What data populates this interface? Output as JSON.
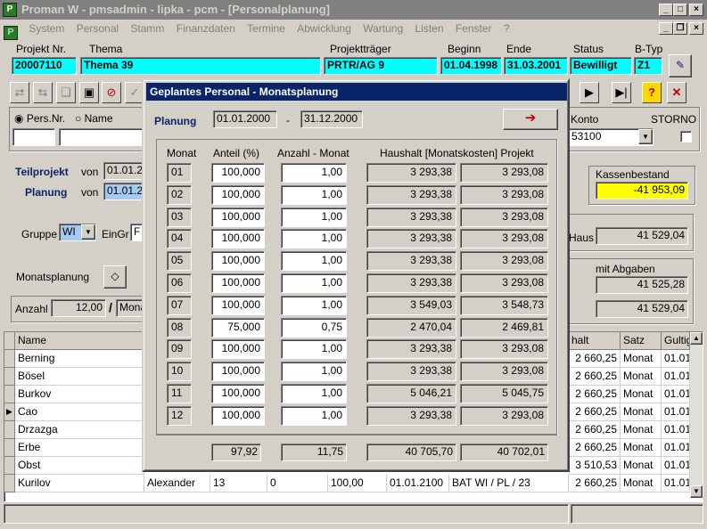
{
  "window": {
    "title": "Proman W - pmsadmin - lipka - pcm - [Personalplanung]"
  },
  "menu": [
    "System",
    "Personal",
    "Stamm",
    "Finanzdaten",
    "Termine",
    "Abwicklung",
    "Wartung",
    "Listen",
    "Fenster",
    "?"
  ],
  "header": {
    "labels": {
      "projekt_nr": "Projekt Nr.",
      "thema": "Thema",
      "traeger": "Projektträger",
      "beginn": "Beginn",
      "ende": "Ende",
      "status": "Status",
      "btyp": "B-Typ"
    },
    "values": {
      "projekt_nr": "20007110",
      "thema": "Thema 39",
      "traeger": "PRTR/AG 9",
      "beginn": "01.04.1998",
      "ende": "31.03.2001",
      "status": "Bewilligt",
      "btyp": "Z1"
    }
  },
  "search": {
    "radio_persnr": "Pers.Nr.",
    "radio_name": "Name",
    "konto_label": "Konto",
    "konto_value": "53100",
    "storno_label": "STORNO"
  },
  "left": {
    "teilprojekt": "Teilprojekt",
    "von": "von",
    "teil_von": "01.01.2",
    "planung": "Planung",
    "plan_von": "01.01.2",
    "gruppe": "Gruppe",
    "gruppe_value": "WI",
    "eingr": "EinGr",
    "eingr_value": "F",
    "monatsplanung": "Monatsplanung",
    "anzahl": "Anzahl",
    "anzahl_value": "12,00",
    "mona": "Mona"
  },
  "right": {
    "kassenbestand": "Kassenbestand",
    "kassen_value": "-41 953,09",
    "haus": "Haus",
    "haus_value": "41 529,04",
    "mit_abgaben": "mit Abgaben",
    "abg1": "41 525,28",
    "abg2": "41 529,04"
  },
  "grid": {
    "headers": {
      "name": "Name",
      "halt": "halt",
      "satz": "Satz",
      "gultig": "Gultig"
    },
    "rows": [
      {
        "name": "Berning",
        "halt": "2 660,25",
        "satz": "Monat",
        "g": "01.01"
      },
      {
        "name": "Bösel",
        "halt": "2 660,25",
        "satz": "Monat",
        "g": "01.01"
      },
      {
        "name": "Burkov",
        "halt": "2 660,25",
        "satz": "Monat",
        "g": "01.01"
      },
      {
        "name": "Cao",
        "halt": "2 660,25",
        "satz": "Monat",
        "g": "01.01"
      },
      {
        "name": "Drzazga",
        "halt": "2 660,25",
        "satz": "Monat",
        "g": "01.01"
      },
      {
        "name": "Erbe",
        "halt": "2 660,25",
        "satz": "Monat",
        "g": "01.01"
      },
      {
        "name": "Obst",
        "halt": "3 510,53",
        "satz": "Monat",
        "g": "01.01"
      },
      {
        "name": "Kurilov",
        "halt": "2 660,25",
        "satz": "Monat",
        "g": "01.01"
      }
    ],
    "last_row_extra": {
      "vorname": "Alexander",
      "c1": "13",
      "c2": "0",
      "c3": "100,00",
      "c4": "01.01.2100",
      "c5": "BAT WI / PL / 23"
    }
  },
  "dialog": {
    "title": "Geplantes Personal - Monatsplanung",
    "planung_label": "Planung",
    "from": "01.01.2000",
    "dash": "-",
    "to": "31.12.2000",
    "col_monat": "Monat",
    "col_anteil": "Anteil (%)",
    "col_anzahl": "Anzahl -  Monat",
    "col_haushalt": "Haushalt [Monatskosten] Projekt",
    "rows": [
      {
        "m": "01",
        "anteil": "100,000",
        "anzahl": "1,00",
        "haushalt": "3 293,38",
        "projekt": "3 293,08"
      },
      {
        "m": "02",
        "anteil": "100,000",
        "anzahl": "1,00",
        "haushalt": "3 293,38",
        "projekt": "3 293,08"
      },
      {
        "m": "03",
        "anteil": "100,000",
        "anzahl": "1,00",
        "haushalt": "3 293,38",
        "projekt": "3 293,08"
      },
      {
        "m": "04",
        "anteil": "100,000",
        "anzahl": "1,00",
        "haushalt": "3 293,38",
        "projekt": "3 293,08"
      },
      {
        "m": "05",
        "anteil": "100,000",
        "anzahl": "1,00",
        "haushalt": "3 293,38",
        "projekt": "3 293,08"
      },
      {
        "m": "06",
        "anteil": "100,000",
        "anzahl": "1,00",
        "haushalt": "3 293,38",
        "projekt": "3 293,08"
      },
      {
        "m": "07",
        "anteil": "100,000",
        "anzahl": "1,00",
        "haushalt": "3 549,03",
        "projekt": "3 548,73"
      },
      {
        "m": "08",
        "anteil": "75,000",
        "anzahl": "0,75",
        "haushalt": "2 470,04",
        "projekt": "2 469,81"
      },
      {
        "m": "09",
        "anteil": "100,000",
        "anzahl": "1,00",
        "haushalt": "3 293,38",
        "projekt": "3 293,08"
      },
      {
        "m": "10",
        "anteil": "100,000",
        "anzahl": "1,00",
        "haushalt": "3 293,38",
        "projekt": "3 293,08"
      },
      {
        "m": "11",
        "anteil": "100,000",
        "anzahl": "1,00",
        "haushalt": "5 046,21",
        "projekt": "5 045,75"
      },
      {
        "m": "12",
        "anteil": "100,000",
        "anzahl": "1,00",
        "haushalt": "3 293,38",
        "projekt": "3 293,08"
      }
    ],
    "totals": {
      "anteil": "97,92",
      "anzahl": "11,75",
      "haushalt": "40 705,70",
      "projekt": "40 702,01"
    }
  }
}
